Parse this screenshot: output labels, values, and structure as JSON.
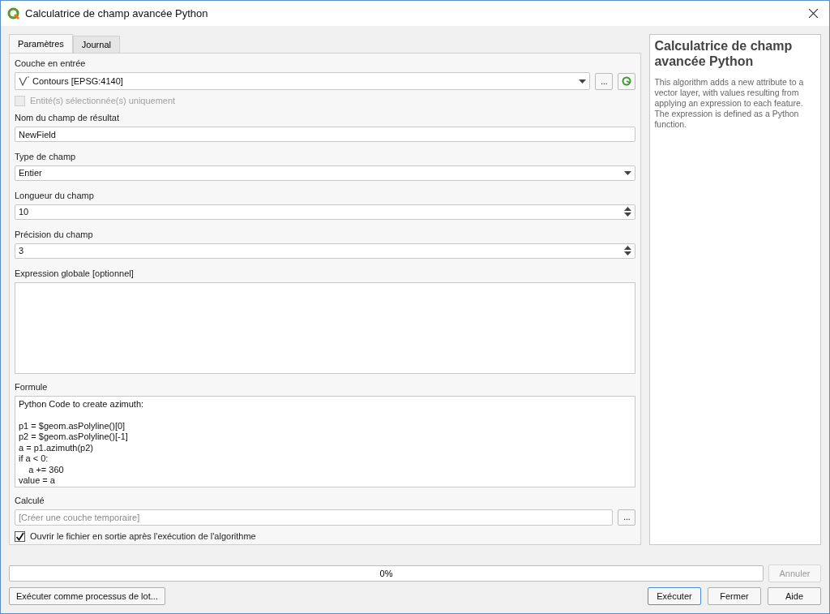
{
  "window": {
    "title": "Calculatrice de champ avancée Python"
  },
  "tabs": [
    {
      "label": "Paramètres",
      "selected": true
    },
    {
      "label": "Journal",
      "selected": false
    }
  ],
  "input_layer": {
    "label": "Couche en entrée",
    "value": "Contours [EPSG:4140]",
    "browse": "..."
  },
  "selected_only": {
    "label": "Entité(s) sélectionnée(s) uniquement",
    "checked": false,
    "disabled": true
  },
  "result_field_name": {
    "label": "Nom du champ de résultat",
    "value": "NewField"
  },
  "field_type": {
    "label": "Type de champ",
    "value": "Entier"
  },
  "field_length": {
    "label": "Longueur du champ",
    "value": "10"
  },
  "field_precision": {
    "label": "Précision du champ",
    "value": "3"
  },
  "global_expression": {
    "label": "Expression globale [optionnel]"
  },
  "formula": {
    "label": "Formule",
    "paragraphs": [
      [
        "Python Code to create azimuth:"
      ],
      [
        "p1 = $geom.asPolyline()[0]",
        "p2 = $geom.asPolyline()[-1]",
        "a = p1.azimuth(p2)",
        "if a < 0:",
        "    a += 360",
        "value = a"
      ]
    ]
  },
  "output": {
    "label": "Calculé",
    "placeholder": "[Créer une couche temporaire]",
    "browse": "..."
  },
  "open_output": {
    "label": "Ouvrir le fichier en sortie après l'exécution de l'algorithme",
    "checked": true,
    "disabled": false
  },
  "help": {
    "title": "Calculatrice de champ avancée Python",
    "text": "This algorithm adds a new attribute to a vector layer, with values resulting from applying an expression to each feature. The expression is defined as a Python function."
  },
  "progress": {
    "level": 0,
    "reading": "0%"
  },
  "buttons": [
    {
      "label": "Annuler",
      "disabled": true
    },
    {
      "label": "Exécuter comme processus de lot...",
      "disabled": false
    },
    {
      "label": "Exécuter",
      "disabled": false,
      "default": true
    },
    {
      "label": "Fermer",
      "disabled": false,
      "default": false
    },
    {
      "label": "Aide",
      "disabled": false,
      "default": false
    }
  ]
}
